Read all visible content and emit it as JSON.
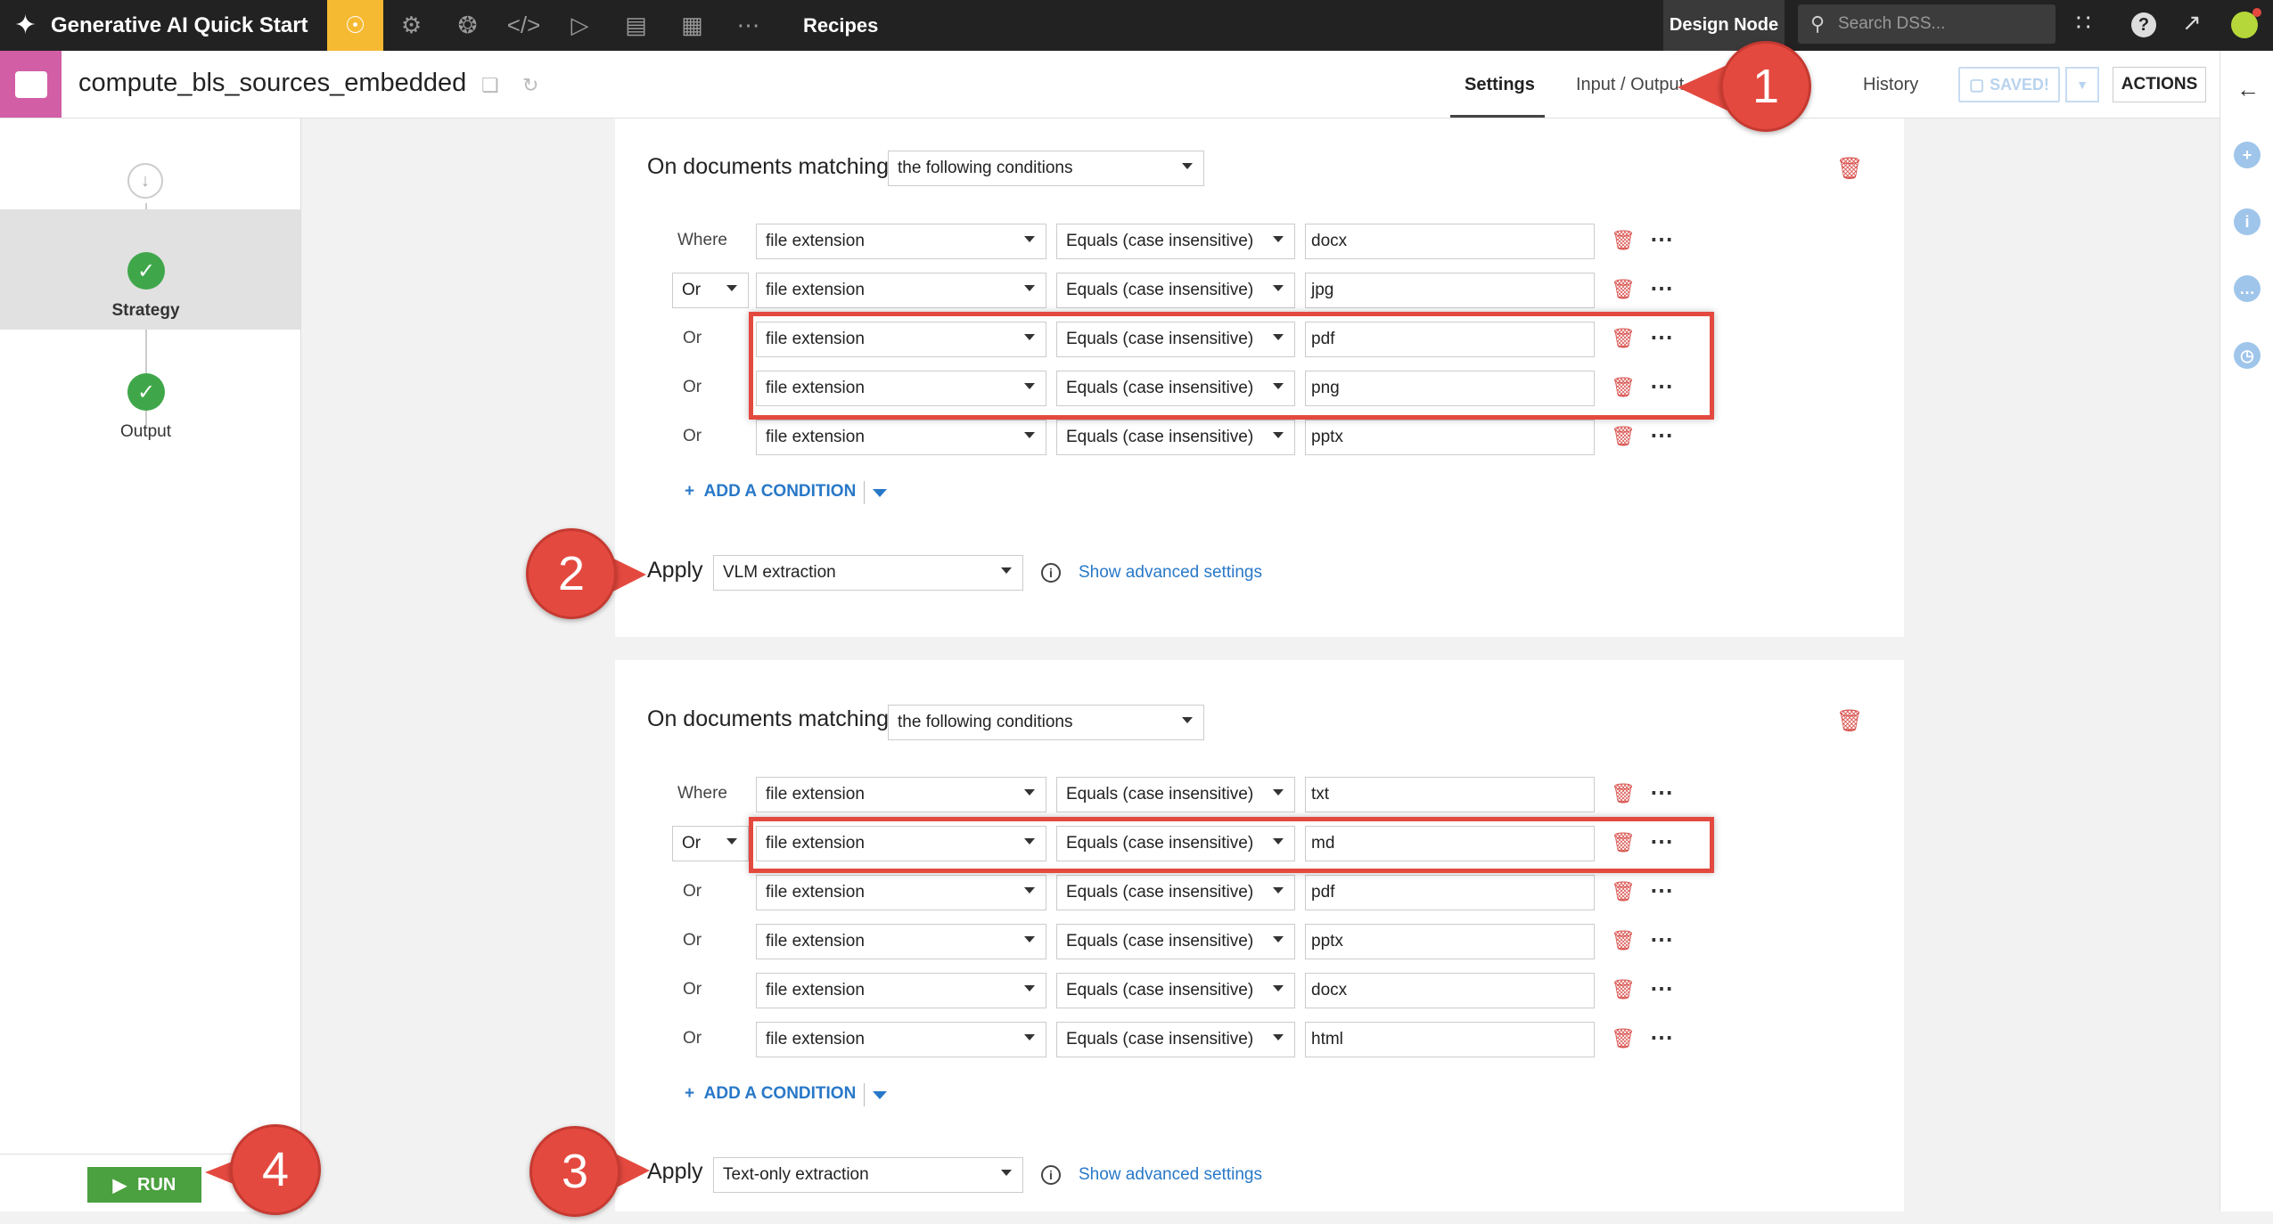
{
  "topbar": {
    "project_title": "Generative AI Quick Start",
    "section": "Recipes",
    "node_label": "Design Node",
    "search_placeholder": "Search DSS...",
    "nav_icons": [
      "flow-icon",
      "lab-icon",
      "deploy-icon",
      "code-icon",
      "run-icon",
      "datasets-icon",
      "dashboard-icon",
      "more-icon"
    ]
  },
  "header": {
    "recipe_name": "compute_bls_sources_embedded",
    "tabs": [
      "Settings",
      "Input / Output",
      "History"
    ],
    "active_tab": "Settings",
    "saved_label": "SAVED!",
    "actions_label": "ACTIONS"
  },
  "sidebar": {
    "steps": [
      {
        "label": "Strategy",
        "status": "done",
        "selected": true
      },
      {
        "label": "Output",
        "status": "done",
        "selected": false
      }
    ],
    "run_label": "RUN"
  },
  "panels": [
    {
      "title": "On documents matching",
      "mode": "the following conditions",
      "conditions": [
        {
          "connector": "Where",
          "field": "file extension",
          "op": "Equals (case insensitive)",
          "value": "docx"
        },
        {
          "connector": "Or",
          "field": "file extension",
          "op": "Equals (case insensitive)",
          "value": "jpg"
        },
        {
          "connector": "Or",
          "field": "file extension",
          "op": "Equals (case insensitive)",
          "value": "pdf"
        },
        {
          "connector": "Or",
          "field": "file extension",
          "op": "Equals (case insensitive)",
          "value": "png"
        },
        {
          "connector": "Or",
          "field": "file extension",
          "op": "Equals (case insensitive)",
          "value": "pptx"
        }
      ],
      "add_label": "ADD A CONDITION",
      "apply_label": "Apply",
      "apply_value": "VLM extraction",
      "advanced_label": "Show advanced settings"
    },
    {
      "title": "On documents matching",
      "mode": "the following conditions",
      "conditions": [
        {
          "connector": "Where",
          "field": "file extension",
          "op": "Equals (case insensitive)",
          "value": "txt"
        },
        {
          "connector": "Or",
          "field": "file extension",
          "op": "Equals (case insensitive)",
          "value": "md"
        },
        {
          "connector": "Or",
          "field": "file extension",
          "op": "Equals (case insensitive)",
          "value": "pdf"
        },
        {
          "connector": "Or",
          "field": "file extension",
          "op": "Equals (case insensitive)",
          "value": "pptx"
        },
        {
          "connector": "Or",
          "field": "file extension",
          "op": "Equals (case insensitive)",
          "value": "docx"
        },
        {
          "connector": "Or",
          "field": "file extension",
          "op": "Equals (case insensitive)",
          "value": "html"
        }
      ],
      "add_label": "ADD A CONDITION",
      "apply_label": "Apply",
      "apply_value": "Text-only extraction",
      "advanced_label": "Show advanced settings"
    }
  ],
  "callouts": [
    "1",
    "2",
    "3",
    "4"
  ],
  "colors": {
    "accent": "#f5b932",
    "link": "#2878c8",
    "danger": "#d9534f",
    "success": "#3fa74a",
    "recipe": "#d25ea5",
    "callout": "#e4493f"
  }
}
